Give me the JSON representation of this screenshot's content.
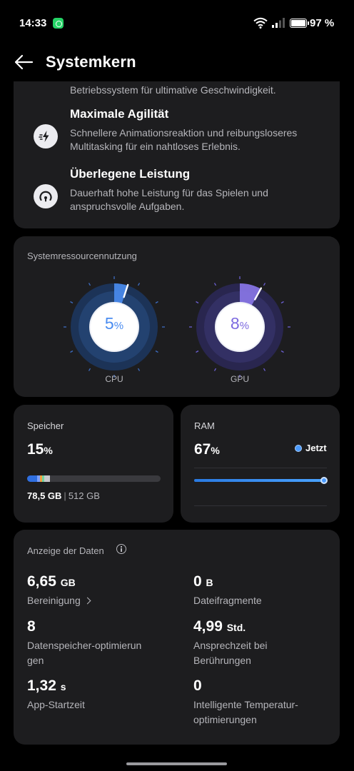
{
  "status_bar": {
    "time": "14:33",
    "notification_icon": "whatsapp-icon",
    "battery": "97 %"
  },
  "header": {
    "title": "Systemkern",
    "back_icon": "arrow-left-icon"
  },
  "features": {
    "continued_text": "Betriebssystem für ultimative Geschwindigkeit.",
    "items": [
      {
        "title": "Maximale Agilität",
        "description": "Schnellere Animationsreaktion und reibungsloseres Multitasking für ein nahtloses Erlebnis.",
        "icon": "lightning-speed-icon"
      },
      {
        "title": "Überlegene Leistung",
        "description": "Dauerhaft hohe Leistung für das Spielen und anspruchsvolle Aufgaben.",
        "icon": "gauge-icon"
      }
    ]
  },
  "resources": {
    "title": "Systemressourcennutzung",
    "cpu": {
      "value": "5",
      "unit": "%",
      "label": "CPU",
      "fraction": 0.05,
      "color": "#4a8cf0"
    },
    "gpu": {
      "value": "8",
      "unit": "%",
      "label": "GPU",
      "fraction": 0.08,
      "color": "#8a78e8"
    }
  },
  "storage": {
    "label": "Speicher",
    "value": "15",
    "unit": "%",
    "used": "78,5 GB",
    "separator": "|",
    "total": "512 GB",
    "fraction": 0.15
  },
  "ram": {
    "label": "RAM",
    "value": "67",
    "unit": "%",
    "legend": "Jetzt",
    "fraction": 0.67
  },
  "data_display": {
    "title": "Anzeige der Daten",
    "metrics": [
      {
        "value": "6,65",
        "unit": "GB",
        "label": "Bereinigung",
        "link": true
      },
      {
        "value": "0",
        "unit": "B",
        "label": "Dateifragmente"
      },
      {
        "value": "8",
        "unit": "",
        "label": "Datenspeicher-optimierun\ngen"
      },
      {
        "value": "4,99",
        "unit": "Std.",
        "label": "Ansprechzeit bei\nBerührungen"
      },
      {
        "value": "1,32",
        "unit": "s",
        "label": "App-Startzeit"
      },
      {
        "value": "0",
        "unit": "",
        "label": "Intelligente Temperatur-\noptimierungen"
      }
    ]
  },
  "colors": {
    "background": "#000000",
    "card": "#1d1d1f",
    "accent_blue": "#4b9bff",
    "accent_purple": "#8a78e8"
  }
}
